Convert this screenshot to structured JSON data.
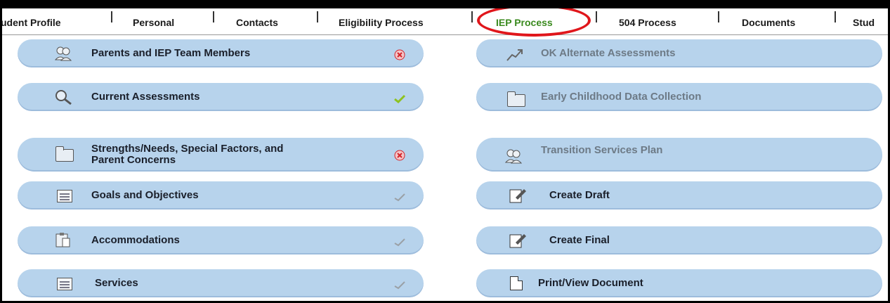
{
  "tabs": [
    {
      "label": "udent Profile",
      "active": false
    },
    {
      "label": "Personal",
      "active": false
    },
    {
      "label": "Contacts",
      "active": false
    },
    {
      "label": "Eligibility Process",
      "active": false
    },
    {
      "label": "IEP Process",
      "active": true
    },
    {
      "label": "504 Process",
      "active": false
    },
    {
      "label": "Documents",
      "active": false
    },
    {
      "label": "Stud",
      "active": false
    }
  ],
  "left_items": [
    {
      "label": "Parents and IEP Team Members",
      "icon": "people-icon",
      "status": "incomplete"
    },
    {
      "label": "Current Assessments",
      "icon": "magnifier-icon",
      "status": "complete"
    },
    {
      "label": "Strengths/Needs, Special Factors, and",
      "label2": "Parent Concerns",
      "icon": "folder-icon",
      "status": "incomplete"
    },
    {
      "label": "Goals and Objectives",
      "icon": "checklist-icon",
      "status": "done"
    },
    {
      "label": "Accommodations",
      "icon": "clipboard-icon",
      "status": "done"
    },
    {
      "label": "Services",
      "icon": "checklist-icon",
      "status": "done"
    }
  ],
  "right_items": [
    {
      "label": "OK Alternate Assessments",
      "icon": "chart-icon",
      "dim": true
    },
    {
      "label": "Early Childhood Data Collection",
      "icon": "folder-icon",
      "dim": true
    },
    {
      "label": "Transition Services Plan",
      "icon": "people-icon",
      "dim": true
    },
    {
      "label": "Create Draft",
      "icon": "edit-document-icon",
      "dim": false
    },
    {
      "label": "Create Final",
      "icon": "edit-document-icon",
      "dim": false
    },
    {
      "label": "Print/View Document",
      "icon": "document-icon",
      "dim": false
    }
  ],
  "colors": {
    "button_fill": "#b7d3ec",
    "active_tab": "#3a8a1e",
    "highlight_circle": "#e0161b",
    "incomplete": "#d4232a",
    "complete": "#8ec21f",
    "done": "#9aa0a6"
  }
}
